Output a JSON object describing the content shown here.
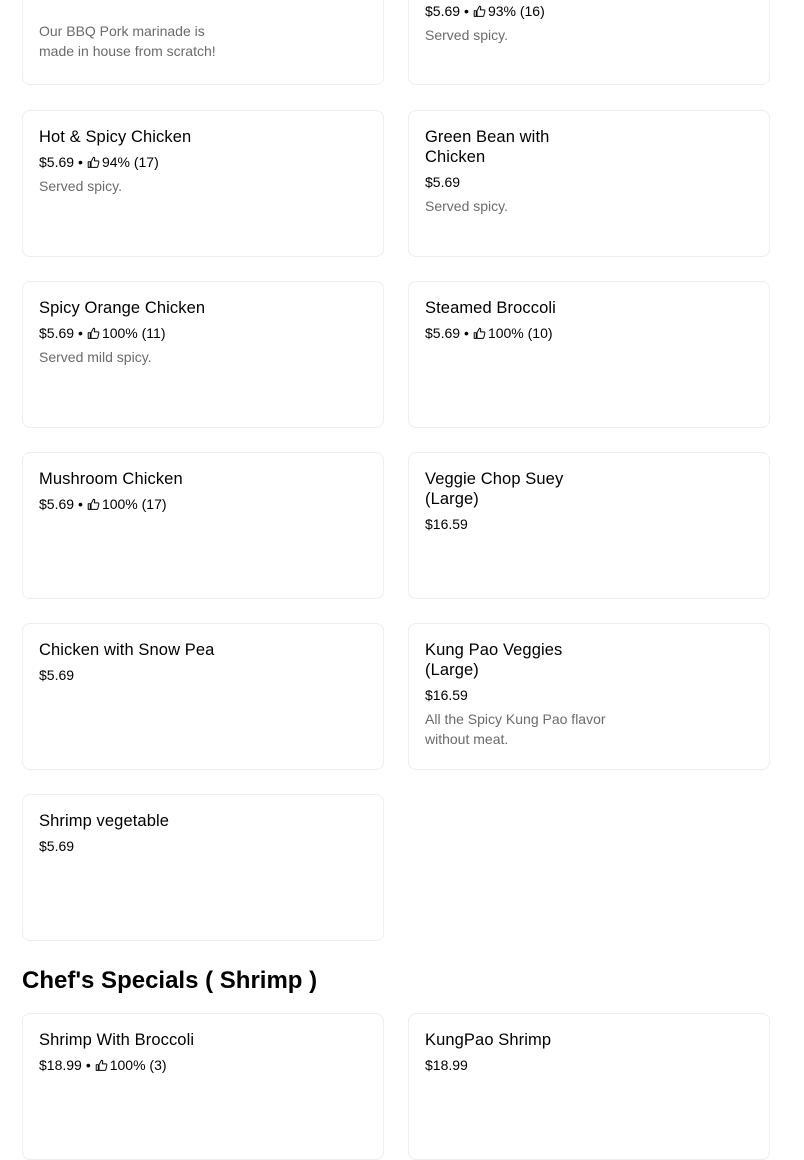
{
  "colors": {
    "card_border": "#eeeeee",
    "description_text": "#6b6b6b",
    "text": "#000000"
  },
  "icons": {
    "rating": "thumbs-up-icon"
  },
  "menu_items": [
    {
      "name": "",
      "price": "",
      "rating": "",
      "description": "Our BBQ Pork marinade is made in house from scratch!"
    },
    {
      "name": "",
      "price": "$5.69",
      "rating": "93% (16)",
      "description": "Served spicy."
    },
    {
      "name": "Hot & Spicy Chicken",
      "price": "$5.69",
      "rating": "94% (17)",
      "description": "Served spicy."
    },
    {
      "name": "Green Bean with Chicken",
      "price": "$5.69",
      "rating": "",
      "description": "Served spicy."
    },
    {
      "name": "Spicy Orange Chicken",
      "price": "$5.69",
      "rating": "100% (11)",
      "description": "Served mild spicy."
    },
    {
      "name": "Steamed Broccoli",
      "price": "$5.69",
      "rating": "100% (10)",
      "description": ""
    },
    {
      "name": "Mushroom Chicken",
      "price": "$5.69",
      "rating": "100% (17)",
      "description": ""
    },
    {
      "name": "Veggie Chop Suey (Large)",
      "price": "$16.59",
      "rating": "",
      "description": ""
    },
    {
      "name": "Chicken with Snow Pea",
      "price": "$5.69",
      "rating": "",
      "description": ""
    },
    {
      "name": "Kung Pao Veggies (Large)",
      "price": "$16.59",
      "rating": "",
      "description": "All the Spicy Kung Pao flavor without meat."
    },
    {
      "name": "Shrimp vegetable",
      "price": "$5.69",
      "rating": "",
      "description": ""
    }
  ],
  "section": {
    "title": "Chef's Specials ( Shrimp )",
    "items": [
      {
        "name": "Shrimp With Broccoli",
        "price": "$18.99",
        "rating": "100% (3)",
        "description": ""
      },
      {
        "name": "KungPao Shrimp",
        "price": "$18.99",
        "rating": "",
        "description": ""
      }
    ]
  }
}
